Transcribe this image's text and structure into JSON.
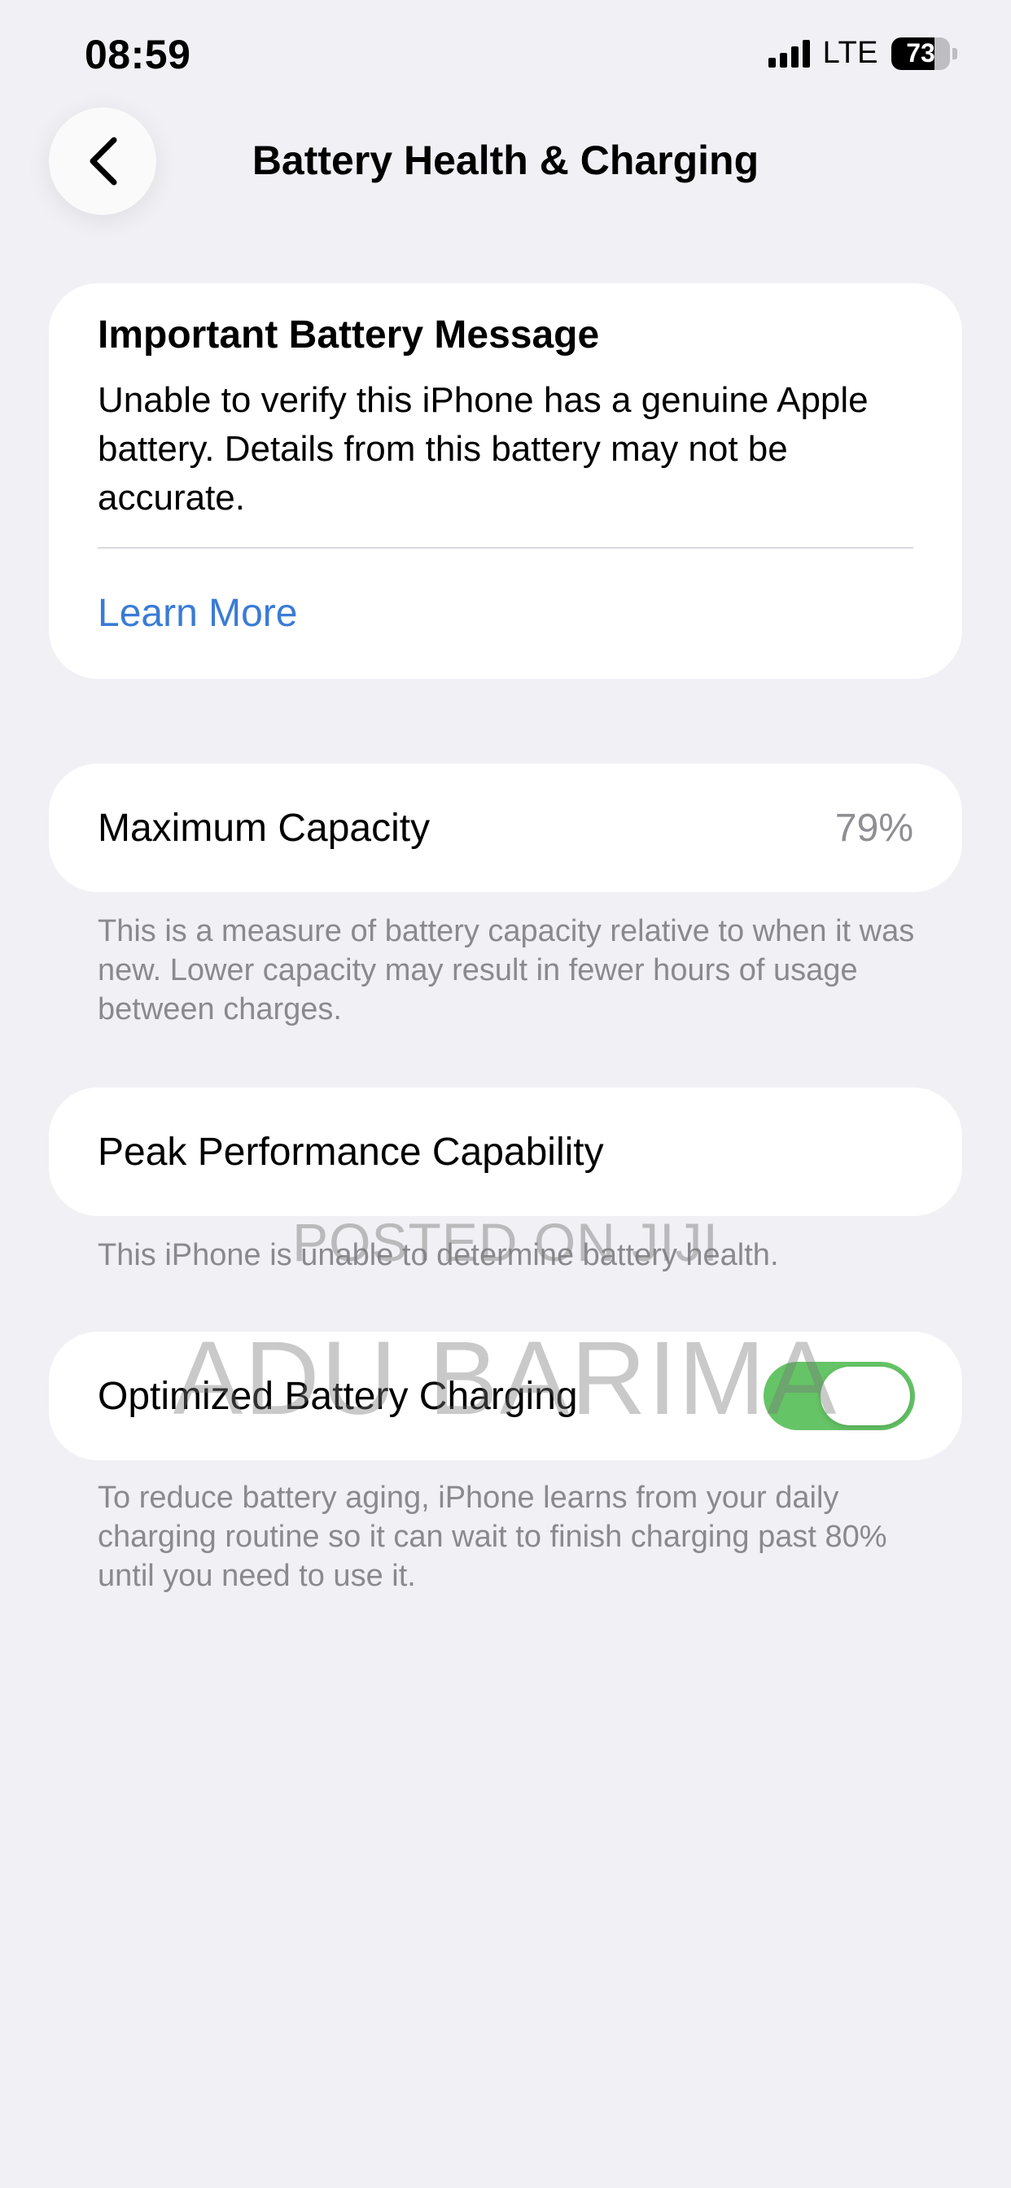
{
  "status_bar": {
    "time": "08:59",
    "network": "LTE",
    "battery_level": "73",
    "battery_fraction": 0.73,
    "signal_bars": 4
  },
  "nav": {
    "back_icon": "chevron-left-icon",
    "title": "Battery Health & Charging"
  },
  "message_card": {
    "title": "Important Battery Message",
    "body": "Unable to verify this iPhone has a genuine Apple battery. Details from this battery may not be accurate.",
    "link": "Learn More"
  },
  "maximum_capacity": {
    "label": "Maximum Capacity",
    "value": "79%",
    "footnote": "This is a measure of battery capacity relative to when it was new. Lower capacity may result in fewer hours of usage between charges."
  },
  "peak_performance": {
    "label": "Peak Performance Capability",
    "footnote": "This iPhone is unable to determine battery health."
  },
  "optimized_charging": {
    "label": "Optimized Battery Charging",
    "enabled": true,
    "footnote": "To reduce battery aging, iPhone learns from your daily charging routine so it can wait to finish charging past 80% until you need to use it."
  },
  "watermark": {
    "line1": "POSTED ON JIJI",
    "line2": "ADU BARIMA"
  },
  "colors": {
    "background": "#f0f0f5",
    "link": "#3a7bd5",
    "toggle_on": "#65c466",
    "secondary_text": "#8a8a8e"
  }
}
